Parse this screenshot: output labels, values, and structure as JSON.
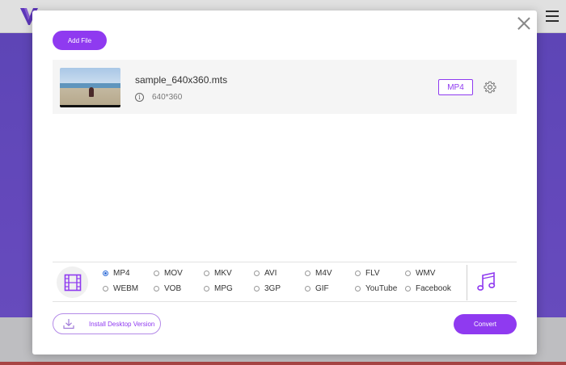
{
  "colors": {
    "accent": "#8f3af0",
    "background_purple": "#6d54c9",
    "radio_selected": "#2f6dd8"
  },
  "header": {
    "logo_icon": "brand-logo-icon",
    "menu_icon": "hamburger-menu-icon"
  },
  "modal": {
    "add_file_label": "Add File",
    "close_icon": "close-icon",
    "file": {
      "name": "sample_640x360.mts",
      "resolution": "640*360",
      "info_icon": "info-icon",
      "info_glyph": "i",
      "format": "MP4",
      "settings_icon": "gear-icon"
    },
    "formats": {
      "video_tab_icon": "film-icon",
      "audio_tab_icon": "music-note-icon",
      "selected": "MP4",
      "options": [
        "MP4",
        "MOV",
        "MKV",
        "AVI",
        "M4V",
        "FLV",
        "WMV",
        "WEBM",
        "VOB",
        "MPG",
        "3GP",
        "GIF",
        "YouTube",
        "Facebook"
      ]
    },
    "install_label": "Install Desktop Version",
    "install_icon": "download-icon",
    "convert_label": "Convert"
  }
}
